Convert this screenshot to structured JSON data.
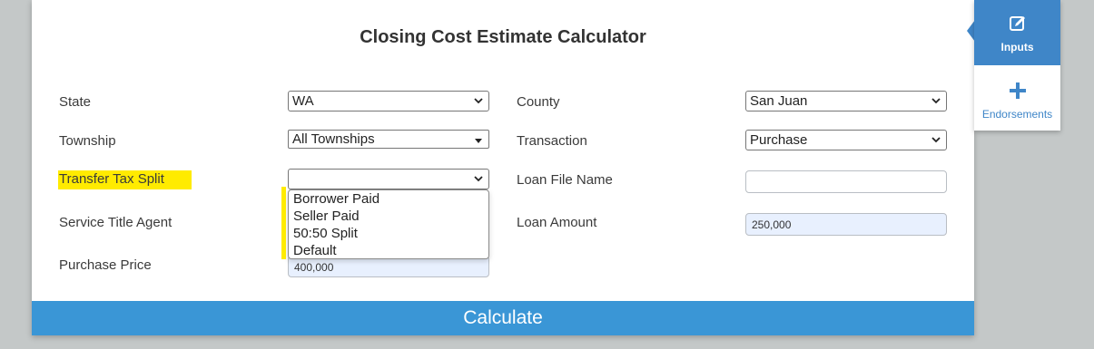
{
  "title": "Closing Cost Estimate Calculator",
  "fields": {
    "state": {
      "label": "State",
      "value": "WA"
    },
    "township": {
      "label": "Township",
      "value": "All Townships"
    },
    "transfer_tax_split": {
      "label": "Transfer Tax Split",
      "value": ""
    },
    "service_title_agent": {
      "label": "Service Title Agent"
    },
    "purchase_price": {
      "label": "Purchase Price",
      "value": "400,000"
    },
    "county": {
      "label": "County",
      "value": "San Juan"
    },
    "transaction": {
      "label": "Transaction",
      "value": "Purchase"
    },
    "loan_file_name": {
      "label": "Loan File Name",
      "value": ""
    },
    "loan_amount": {
      "label": "Loan Amount",
      "value": "250,000"
    }
  },
  "dropdown_options": [
    "Borrower Paid",
    "Seller Paid",
    "50:50 Split",
    "Default"
  ],
  "calculate_label": "Calculate",
  "side_tabs": {
    "inputs": {
      "label": "Inputs",
      "icon": "edit-icon"
    },
    "endorsements": {
      "label": "Endorsements",
      "icon": "plus-icon"
    }
  },
  "colors": {
    "accent": "#3a96d6",
    "tab_active": "#3f86c8",
    "highlight": "#ffeb00",
    "background": "#c4c8c8"
  }
}
